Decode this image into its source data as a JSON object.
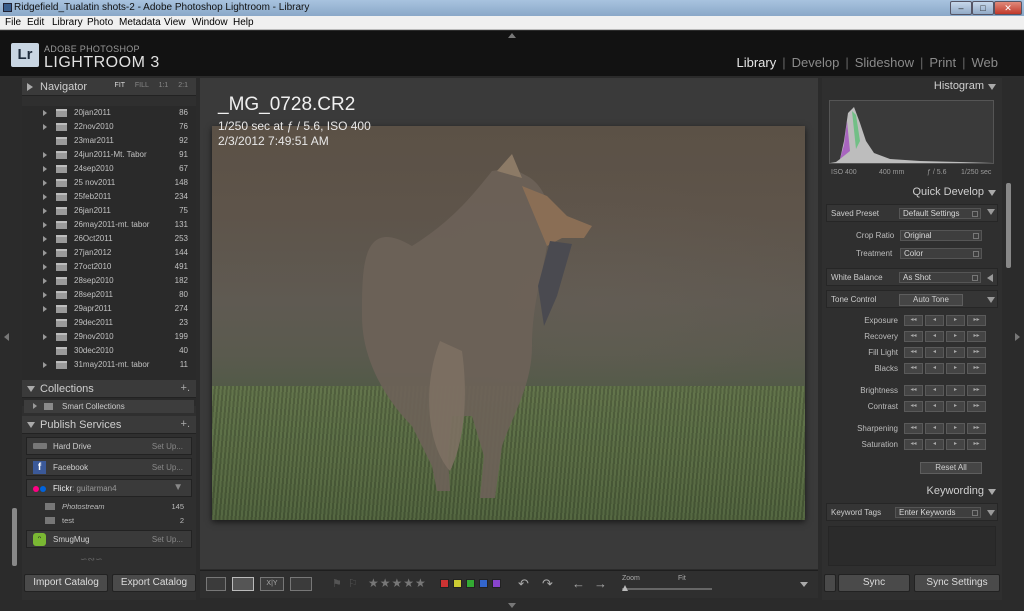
{
  "window": {
    "title": "Ridgefield_Tualatin shots-2 - Adobe Photoshop Lightroom - Library"
  },
  "menu": [
    "File",
    "Edit",
    "Library",
    "Photo",
    "Metadata",
    "View",
    "Window",
    "Help"
  ],
  "brand": {
    "logo": "Lr",
    "small": "ADOBE PHOTOSHOP",
    "big": "LIGHTROOM 3"
  },
  "modules": [
    "Library",
    "Develop",
    "Slideshow",
    "Print",
    "Web"
  ],
  "navigator": {
    "label": "Navigator",
    "options": [
      "FIT",
      "FILL",
      "1:1",
      "2:1"
    ]
  },
  "folders": [
    {
      "name": "20jan2011",
      "count": "86"
    },
    {
      "name": "22nov2010",
      "count": "76"
    },
    {
      "name": "23mar2011",
      "count": "92"
    },
    {
      "name": "24jun2011-Mt. Tabor",
      "count": "91"
    },
    {
      "name": "24sep2010",
      "count": "67"
    },
    {
      "name": "25 nov2011",
      "count": "148"
    },
    {
      "name": "25feb2011",
      "count": "234"
    },
    {
      "name": "26jan2011",
      "count": "75"
    },
    {
      "name": "26may2011-mt. tabor",
      "count": "131"
    },
    {
      "name": "26Oct2011",
      "count": "253"
    },
    {
      "name": "27jan2012",
      "count": "144"
    },
    {
      "name": "27oct2010",
      "count": "491"
    },
    {
      "name": "28sep2010",
      "count": "182"
    },
    {
      "name": "28sep2011",
      "count": "80"
    },
    {
      "name": "29apr2011",
      "count": "274"
    },
    {
      "name": "29dec2011",
      "count": "23"
    },
    {
      "name": "29nov2010",
      "count": "199"
    },
    {
      "name": "30dec2010",
      "count": "40"
    },
    {
      "name": "31may2011-mt. tabor",
      "count": "11"
    }
  ],
  "collections": {
    "label": "Collections",
    "smart": "Smart Collections"
  },
  "publish": {
    "label": "Publish Services",
    "hard_drive": "Hard Drive",
    "facebook": "Facebook",
    "flickr": "Flickr",
    "flickr_user": ": guitarman4",
    "photostream": "Photostream",
    "photostream_count": "145",
    "test": "test",
    "test_count": "2",
    "smugmug": "SmugMug",
    "setup": "Set Up..."
  },
  "left_buttons": {
    "import": "Import Catalog",
    "export": "Export Catalog"
  },
  "photo": {
    "name": "_MG_0728.CR2",
    "exposure": "1/250 sec at ƒ / 5.6, ISO 400",
    "date": "2/3/2012 7:49:51 AM"
  },
  "toolbar": {
    "stars": "★★★★★",
    "zoom": "Zoom",
    "fit": "Fit",
    "colors": [
      "#cc3333",
      "#cccc33",
      "#33aa33",
      "#3366cc",
      "#8844cc"
    ]
  },
  "histogram": {
    "label": "Histogram",
    "iso": "ISO 400",
    "focal": "400 mm",
    "aperture": "ƒ / 5.6",
    "shutter": "1/250 sec"
  },
  "quick_develop": {
    "label": "Quick Develop",
    "saved_preset": "Saved Preset",
    "preset_value": "Default Settings",
    "crop_ratio": "Crop Ratio",
    "crop_value": "Original",
    "treatment": "Treatment",
    "treatment_value": "Color",
    "white_balance": "White Balance",
    "wb_value": "As Shot",
    "tone_control": "Tone Control",
    "auto_tone": "Auto Tone",
    "exposure": "Exposure",
    "recovery": "Recovery",
    "fill_light": "Fill Light",
    "blacks": "Blacks",
    "brightness": "Brightness",
    "contrast": "Contrast",
    "sharpening": "Sharpening",
    "saturation": "Saturation",
    "reset_all": "Reset All"
  },
  "keywording": {
    "label": "Keywording",
    "tags": "Keyword Tags",
    "enter": "Enter Keywords"
  },
  "sync": {
    "sync": "Sync",
    "sync_settings": "Sync Settings"
  }
}
